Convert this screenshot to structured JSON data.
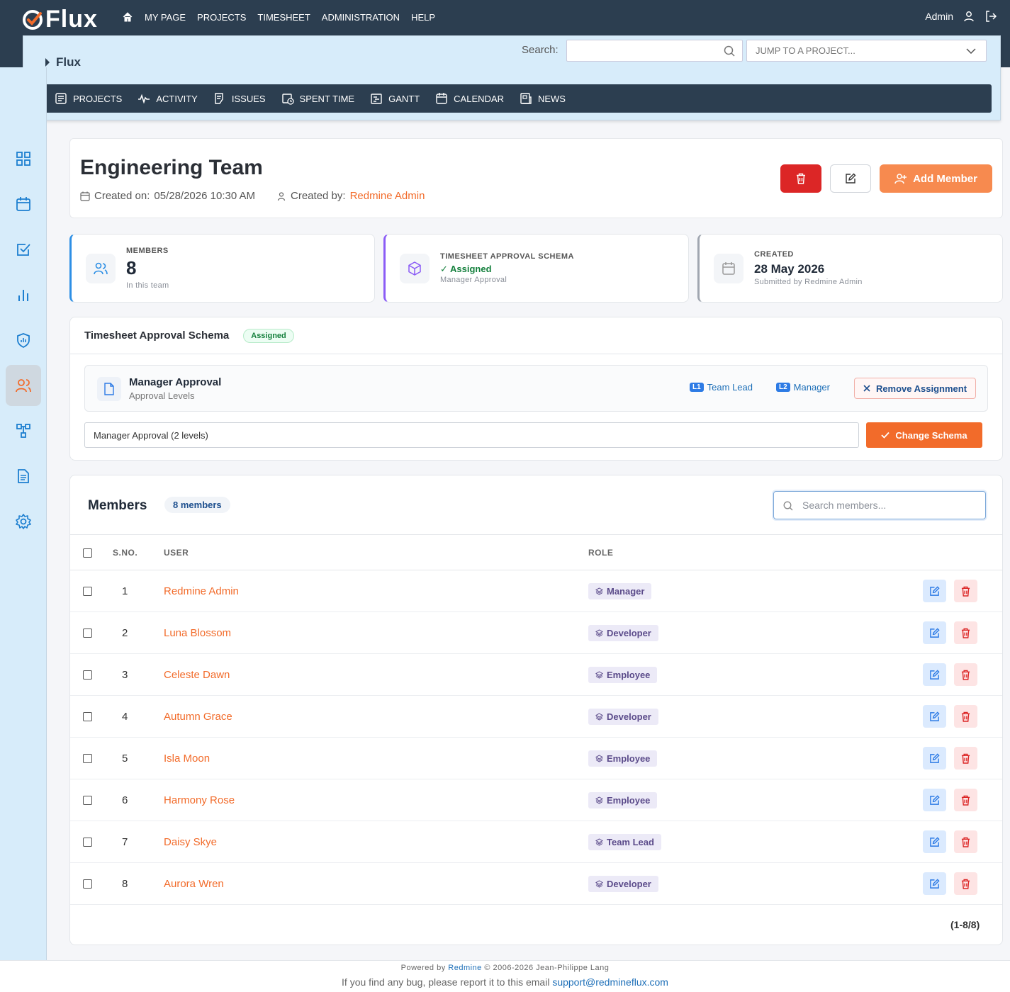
{
  "app": {
    "logo": "Flux",
    "user": "Admin"
  },
  "topnav": [
    "MY PAGE",
    "PROJECTS",
    "TIMESHEET",
    "ADMINISTRATION",
    "HELP"
  ],
  "header": {
    "project": "Flux",
    "search_label": "Search:",
    "search_value": "",
    "jump_placeholder": "JUMP TO A PROJECT..."
  },
  "subnav": [
    {
      "label": "PROJECTS",
      "icon": "projects-icon"
    },
    {
      "label": "ACTIVITY",
      "icon": "activity-icon"
    },
    {
      "label": "ISSUES",
      "icon": "issues-icon"
    },
    {
      "label": "SPENT TIME",
      "icon": "spent-time-icon"
    },
    {
      "label": "GANTT",
      "icon": "gantt-icon"
    },
    {
      "label": "CALENDAR",
      "icon": "calendar-icon"
    },
    {
      "label": "NEWS",
      "icon": "news-icon"
    }
  ],
  "sidebar": [
    "dashboard-icon",
    "calendar-icon",
    "checklist-icon",
    "chart-icon",
    "shield-icon",
    "users-icon",
    "hierarchy-icon",
    "document-icon",
    "settings-icon"
  ],
  "team": {
    "title": "Engineering Team",
    "created_on_label": "Created on:",
    "created_on": "05/28/2026 10:30 AM",
    "created_by_label": "Created by:",
    "created_by": "Redmine Admin",
    "add_member": "Add Member"
  },
  "stats": {
    "members": {
      "label": "MEMBERS",
      "value": "8",
      "sub": "In this team"
    },
    "schema": {
      "label": "TIMESHEET APPROVAL SCHEMA",
      "value": "✓ Assigned",
      "sub": "Manager Approval"
    },
    "created": {
      "label": "CREATED",
      "value": "28 May 2026",
      "sub": "Submitted by Redmine Admin"
    }
  },
  "schema": {
    "title": "Timesheet Approval Schema",
    "status": "Assigned",
    "name": "Manager Approval",
    "subtitle": "Approval Levels",
    "levels": [
      {
        "tag": "L1",
        "name": "Team Lead"
      },
      {
        "tag": "L2",
        "name": "Manager"
      }
    ],
    "remove": "Remove Assignment",
    "selected": "Manager Approval (2 levels)",
    "change": "Change Schema"
  },
  "members": {
    "title": "Members",
    "count": "8 members",
    "search_placeholder": "Search members...",
    "columns": {
      "sno": "S.NO.",
      "user": "USER",
      "role": "ROLE"
    },
    "rows": [
      {
        "sno": "1",
        "user": "Redmine Admin",
        "role": "Manager"
      },
      {
        "sno": "2",
        "user": "Luna Blossom",
        "role": "Developer"
      },
      {
        "sno": "3",
        "user": "Celeste Dawn",
        "role": "Employee"
      },
      {
        "sno": "4",
        "user": "Autumn Grace",
        "role": "Developer"
      },
      {
        "sno": "5",
        "user": "Isla Moon",
        "role": "Employee"
      },
      {
        "sno": "6",
        "user": "Harmony Rose",
        "role": "Employee"
      },
      {
        "sno": "7",
        "user": "Daisy Skye",
        "role": "Team Lead"
      },
      {
        "sno": "8",
        "user": "Aurora Wren",
        "role": "Developer"
      }
    ],
    "pager": "(1-8/8)"
  },
  "footer": {
    "powered": "Powered by",
    "redmine": "Redmine",
    "copyright": "© 2006-2026 Jean-Philippe Lang",
    "bug_text": "If you find any bug, please report it to this email",
    "email": "support@redmineflux.com"
  },
  "colors": {
    "primary": "#2c3e50",
    "accent": "#f26b2a",
    "danger": "#dc2626",
    "light": "#d7ecfa"
  }
}
